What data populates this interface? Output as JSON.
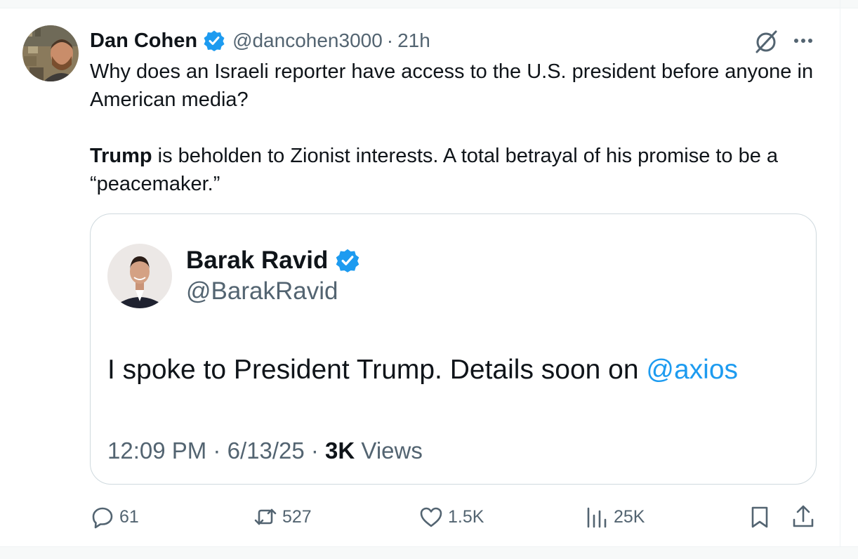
{
  "tweet": {
    "author_name": "Dan Cohen",
    "handle": "@dancohen3000",
    "separator": "·",
    "time": "21h",
    "text_line1": "Why does an Israeli reporter have access to the U.S. president before anyone in American media?",
    "text_bold": "Trump",
    "text_line2_rest": " is beholden to Zionist interests. A total betrayal of his promise to be a “peacemaker.”"
  },
  "quote": {
    "author_name": "Barak Ravid",
    "handle": "@BarakRavid",
    "text": "I spoke to President Trump. Details soon on ",
    "mention": "@axios",
    "time": "12:09 PM",
    "separator1": "·",
    "date": "6/13/25",
    "separator2": "·",
    "views_count": "3K",
    "views_label": "Views"
  },
  "actions": {
    "replies": "61",
    "reposts": "527",
    "likes": "1.5K",
    "views": "25K"
  },
  "icons": {
    "verified": "verified-badge-icon",
    "grok": "grok-icon",
    "more": "more-icon",
    "reply": "reply-icon",
    "repost": "repost-icon",
    "like": "like-icon",
    "views": "views-icon",
    "bookmark": "bookmark-icon",
    "share": "share-icon"
  },
  "colors": {
    "accent": "#1d9bf0",
    "text": "#0f1419",
    "secondary": "#536471",
    "border": "#cfd9de"
  }
}
